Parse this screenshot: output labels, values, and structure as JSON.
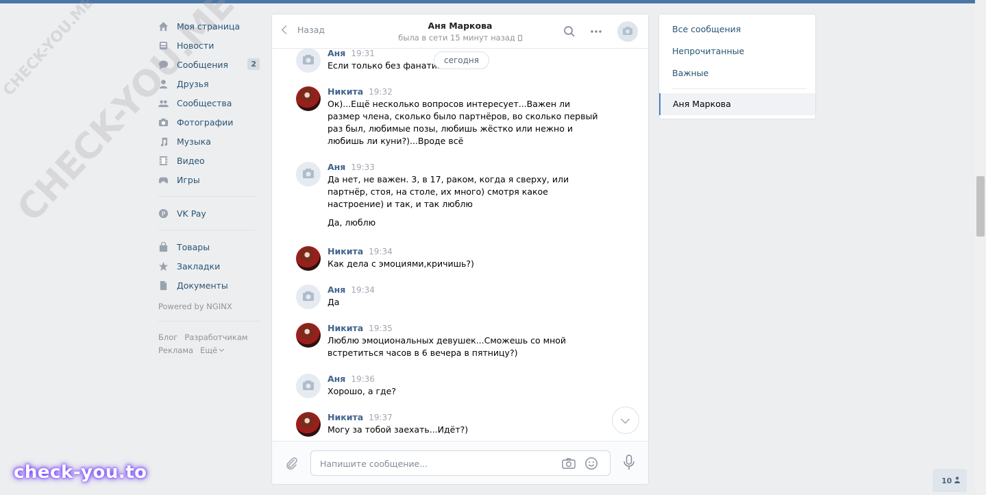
{
  "colors": {
    "accent": "#4a76a8",
    "link": "#285473",
    "author": "#42648b",
    "background": "#edeef0"
  },
  "watermarks": {
    "diagonal_small": "CHECK-YOU.ME",
    "diagonal_large": "CHECK-YOU.ME",
    "bottom": "check-you.to"
  },
  "leftnav": {
    "items": [
      {
        "label": "Моя страница",
        "icon": "home-icon"
      },
      {
        "label": "Новости",
        "icon": "news-icon"
      },
      {
        "label": "Сообщения",
        "icon": "messages-icon",
        "badge": "2"
      },
      {
        "label": "Друзья",
        "icon": "friends-icon"
      },
      {
        "label": "Сообщества",
        "icon": "groups-icon"
      },
      {
        "label": "Фотографии",
        "icon": "camera-icon"
      },
      {
        "label": "Музыка",
        "icon": "music-icon"
      },
      {
        "label": "Видео",
        "icon": "video-icon"
      },
      {
        "label": "Игры",
        "icon": "gamepad-icon"
      }
    ],
    "vkpay": {
      "label": "VK Pay",
      "icon": "vkpay-icon"
    },
    "extras": [
      {
        "label": "Товары",
        "icon": "bag-icon"
      },
      {
        "label": "Закладки",
        "icon": "star-icon"
      },
      {
        "label": "Документы",
        "icon": "document-icon"
      }
    ],
    "powered": "Powered by NGINX",
    "footer": {
      "blog": "Блог",
      "developers": "Разработчикам",
      "ads": "Реклама",
      "more": "Ещё"
    }
  },
  "chat": {
    "back_label": "Назад",
    "name": "Аня Маркова",
    "status": "была в сети 15 минут назад",
    "date_pill": "сегодня",
    "messages": [
      {
        "author": "Аня",
        "time": "19:31",
        "text": "Если только без фанатизма",
        "avatar": "camera-placeholder"
      },
      {
        "author": "Никита",
        "time": "19:32",
        "text": "Ок)...Ещё несколько вопросов интересует...Важен ли размер члена, сколько было партнёров, во сколько первый раз был, любимые позы, любишь жёстко или нежно и любишь ли куни?)...Вроде всё",
        "avatar": "photo"
      },
      {
        "author": "Аня",
        "time": "19:33",
        "text": "Да нет, не важен. 3, в 17, раком, когда я сверху, или партнёр, стоя, на столе, их много) смотря какое настроение) и так, и так люблю",
        "text2": "Да, люблю",
        "avatar": "camera-placeholder"
      },
      {
        "author": "Никита",
        "time": "19:34",
        "text": "Как дела с эмоциями,кричишь?)",
        "avatar": "photo"
      },
      {
        "author": "Аня",
        "time": "19:34",
        "text": "Да",
        "avatar": "camera-placeholder"
      },
      {
        "author": "Никита",
        "time": "19:35",
        "text": "Люблю эмоциональных девушек...Сможешь со мной встретиться часов в 6 вечера в пятницу?)",
        "avatar": "photo"
      },
      {
        "author": "Аня",
        "time": "19:36",
        "text": "Хорошо, а где?",
        "avatar": "camera-placeholder"
      },
      {
        "author": "Никита",
        "time": "19:37",
        "text": "Могу за тобой заехать...Идёт?)",
        "avatar": "photo"
      }
    ],
    "composer": {
      "placeholder": "Напишите сообщение..."
    }
  },
  "filters": {
    "all": "Все сообщения",
    "unread": "Непрочитанные",
    "important": "Важные",
    "active_dialog": "Аня Маркова"
  },
  "online_count": "10"
}
